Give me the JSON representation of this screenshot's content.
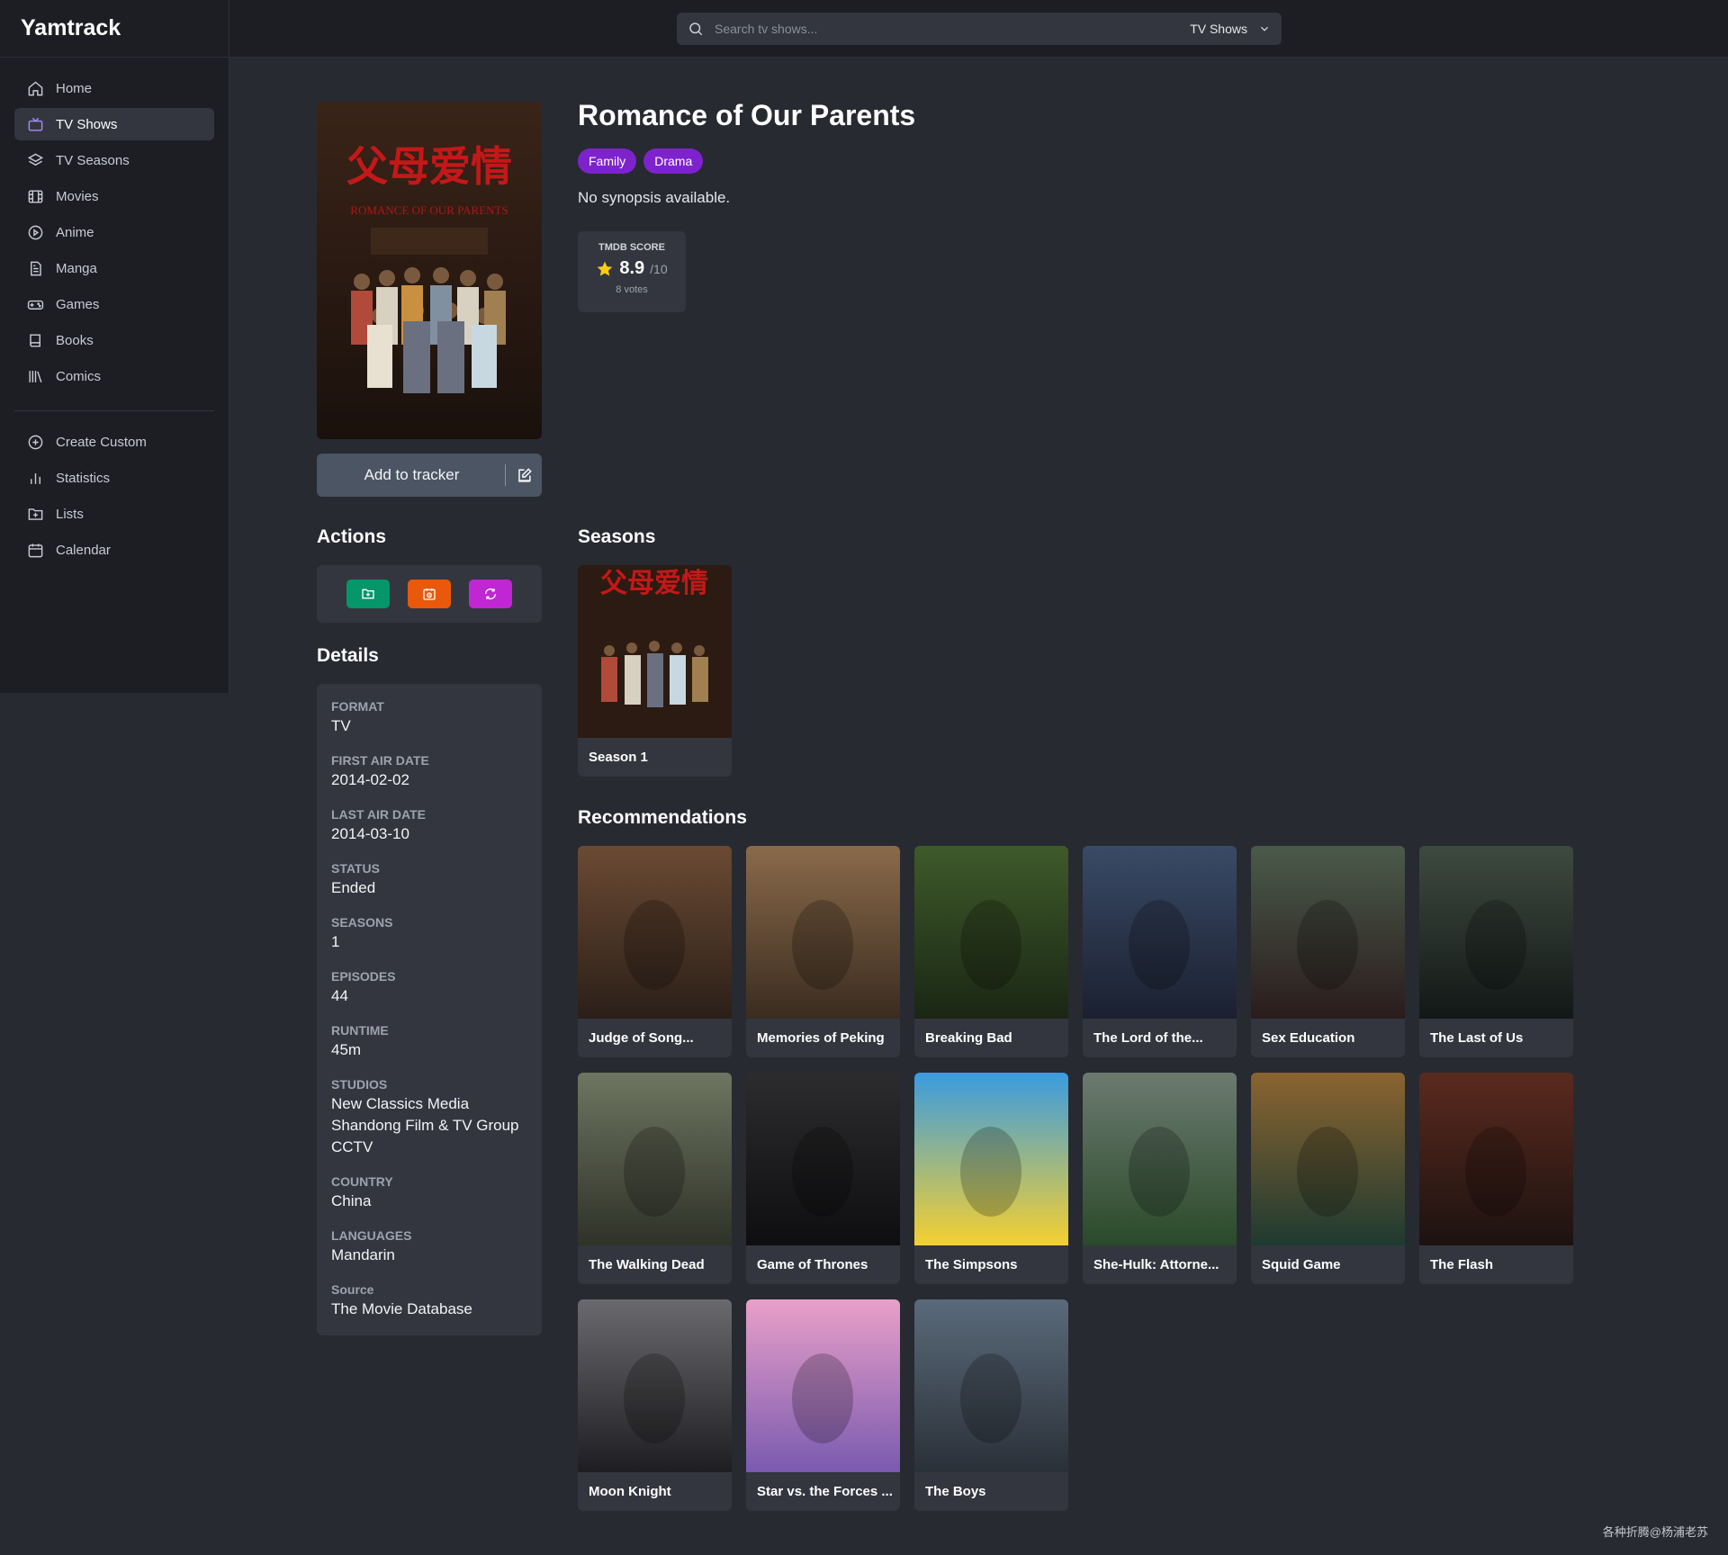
{
  "app": {
    "name": "Yamtrack"
  },
  "search": {
    "placeholder": "Search tv shows...",
    "type": "TV Shows"
  },
  "sidebar": {
    "items": [
      {
        "label": "Home",
        "icon": "home-icon"
      },
      {
        "label": "TV Shows",
        "icon": "tv-icon",
        "active": true
      },
      {
        "label": "TV Seasons",
        "icon": "layers-icon"
      },
      {
        "label": "Movies",
        "icon": "film-icon"
      },
      {
        "label": "Anime",
        "icon": "play-circle-icon"
      },
      {
        "label": "Manga",
        "icon": "document-icon"
      },
      {
        "label": "Games",
        "icon": "gamepad-icon"
      },
      {
        "label": "Books",
        "icon": "book-icon"
      },
      {
        "label": "Comics",
        "icon": "library-icon"
      }
    ],
    "secondary": [
      {
        "label": "Create Custom",
        "icon": "plus-circle-icon"
      },
      {
        "label": "Statistics",
        "icon": "bar-chart-icon"
      },
      {
        "label": "Lists",
        "icon": "folder-plus-icon"
      },
      {
        "label": "Calendar",
        "icon": "calendar-icon"
      }
    ]
  },
  "media": {
    "title": "Romance of Our Parents",
    "poster_text": {
      "cn": "父母爱情",
      "en": "ROMANCE OF OUR PARENTS"
    },
    "genres": [
      "Family",
      "Drama"
    ],
    "synopsis": "No synopsis available.",
    "score": {
      "label": "TMDB SCORE",
      "value": "8.9",
      "max": "/10",
      "votes": "8 votes"
    }
  },
  "tracker": {
    "add_label": "Add to tracker"
  },
  "sections": {
    "actions": "Actions",
    "details": "Details",
    "seasons": "Seasons",
    "recommendations": "Recommendations"
  },
  "actions": [
    {
      "name": "add-to-list",
      "color": "#059669",
      "icon": "folder-plus-icon"
    },
    {
      "name": "history",
      "color": "#ea580c",
      "icon": "calendar-clock-icon"
    },
    {
      "name": "sync",
      "color": "#c026d3",
      "icon": "refresh-icon"
    }
  ],
  "details": [
    {
      "label": "FORMAT",
      "values": [
        "TV"
      ]
    },
    {
      "label": "FIRST AIR DATE",
      "values": [
        "2014-02-02"
      ]
    },
    {
      "label": "LAST AIR DATE",
      "values": [
        "2014-03-10"
      ]
    },
    {
      "label": "STATUS",
      "values": [
        "Ended"
      ]
    },
    {
      "label": "SEASONS",
      "values": [
        "1"
      ]
    },
    {
      "label": "EPISODES",
      "values": [
        "44"
      ]
    },
    {
      "label": "RUNTIME",
      "values": [
        "45m"
      ]
    },
    {
      "label": "STUDIOS",
      "values": [
        "New Classics Media",
        "Shandong Film & TV Group",
        "CCTV"
      ]
    },
    {
      "label": "COUNTRY",
      "values": [
        "China"
      ]
    },
    {
      "label": "LANGUAGES",
      "values": [
        "Mandarin"
      ]
    },
    {
      "label": "Source",
      "values": [
        "The Movie Database"
      ]
    }
  ],
  "seasons": [
    {
      "title": "Season 1"
    }
  ],
  "recommendations": [
    {
      "title": "Judge of Song...",
      "bg": [
        "#6b4a33",
        "#2a1f18"
      ]
    },
    {
      "title": "Memories of Peking",
      "bg": [
        "#8a6a4a",
        "#3a2c20"
      ]
    },
    {
      "title": "Breaking Bad",
      "bg": [
        "#3e5a2a",
        "#1a2614"
      ]
    },
    {
      "title": "The Lord of the...",
      "bg": [
        "#3a4a66",
        "#1a2030"
      ]
    },
    {
      "title": "Sex Education",
      "bg": [
        "#4a5a4a",
        "#2a1c1c"
      ]
    },
    {
      "title": "The Last of Us",
      "bg": [
        "#3e4a40",
        "#121816"
      ]
    },
    {
      "title": "The Walking Dead",
      "bg": [
        "#6e7560",
        "#2e3228"
      ]
    },
    {
      "title": "Game of Thrones",
      "bg": [
        "#2c2c2e",
        "#0e0e10"
      ]
    },
    {
      "title": "The Simpsons",
      "bg": [
        "#3a9be0",
        "#f5d030"
      ]
    },
    {
      "title": "She-Hulk: Attorne...",
      "bg": [
        "#6c7a70",
        "#2a4a2a"
      ]
    },
    {
      "title": "Squid Game",
      "bg": [
        "#8a6430",
        "#1e3a30"
      ]
    },
    {
      "title": "The Flash",
      "bg": [
        "#5a2a1e",
        "#1c1210"
      ]
    },
    {
      "title": "Moon Knight",
      "bg": [
        "#6a6a6e",
        "#1e1e22"
      ]
    },
    {
      "title": "Star vs. the Forces ...",
      "bg": [
        "#e8a0c8",
        "#7a5ab0"
      ]
    },
    {
      "title": "The Boys",
      "bg": [
        "#5a6a7a",
        "#2a3038"
      ]
    }
  ],
  "watermark": "各种折腾@杨浦老苏"
}
